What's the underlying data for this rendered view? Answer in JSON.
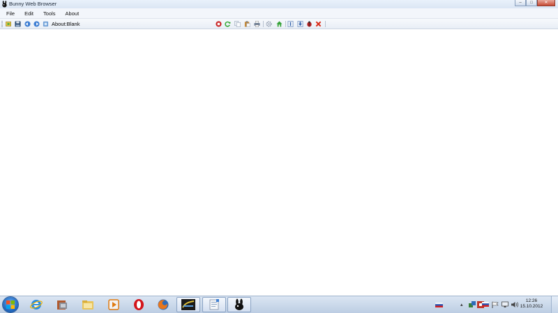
{
  "window": {
    "title": "Bunny Web Browser",
    "controls": {
      "minimize": "–",
      "maximize": "□",
      "close": "✕"
    }
  },
  "menu": {
    "items": [
      "File",
      "Edit",
      "Tools",
      "About"
    ]
  },
  "toolbar": {
    "address": "About:Blank",
    "left_icons": [
      "go-icon",
      "save-icon",
      "back-icon",
      "forward-icon",
      "home-icon"
    ],
    "right_icons": [
      "stop-icon",
      "refresh-icon",
      "copy-icon",
      "paste-icon",
      "print-icon",
      "settings-icon",
      "home-page-icon",
      "info-icon",
      "download-icon",
      "bug-icon",
      "close-tab-icon"
    ]
  },
  "taskbar": {
    "apps": [
      "internet-explorer",
      "app-box",
      "file-explorer",
      "media-player",
      "opera",
      "firefox",
      "video-app",
      "notepad-app",
      "bunny-browser"
    ],
    "active_app": "bunny-browser",
    "clock": {
      "time": "12:26",
      "date": "15.10.2012"
    },
    "language": "RU"
  },
  "colors": {
    "titlebar": "#dbe6f4",
    "taskbar": "#bccde3",
    "close_button": "#c74a35"
  }
}
